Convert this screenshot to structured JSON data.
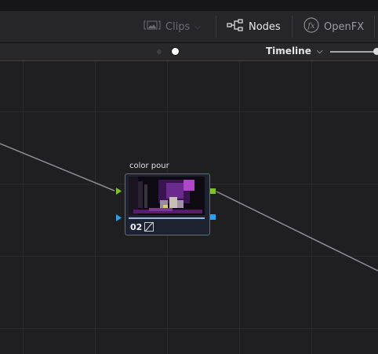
{
  "toolbar": {
    "clips_label": "Clips",
    "nodes_label": "Nodes",
    "openfx_label": "OpenFX"
  },
  "subbar": {
    "timeline_label": "Timeline"
  },
  "node": {
    "title": "color pour",
    "number": "02"
  },
  "colors": {
    "input_rgb": "#7fc32a",
    "input_alpha": "#2e9ee6",
    "node_border": "#4a6ea3",
    "subbar_accent": "#6e2a2f"
  }
}
